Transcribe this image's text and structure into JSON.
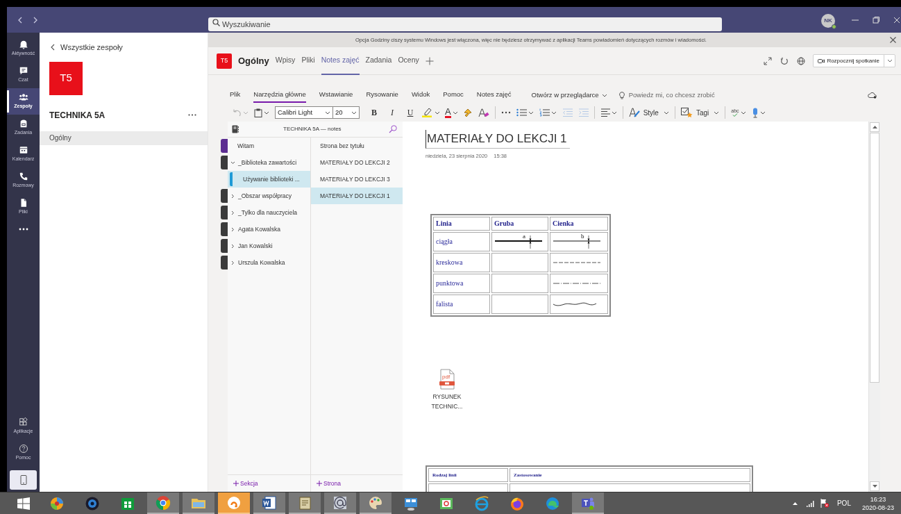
{
  "title_bar": {
    "search": {
      "placeholder": "Wyszukiwanie"
    },
    "avatar": "NK"
  },
  "rail": {
    "items": [
      {
        "kind": "bell",
        "label": "Aktywność",
        "selected": false
      },
      {
        "kind": "chat",
        "label": "Czat",
        "selected": false
      },
      {
        "kind": "people",
        "label": "Zespoły",
        "selected": true
      },
      {
        "kind": "bag",
        "label": "Zadania",
        "selected": false
      },
      {
        "kind": "calendar",
        "label": "Kalendarz",
        "selected": false
      },
      {
        "kind": "phone",
        "label": "Rozmowy",
        "selected": false
      },
      {
        "kind": "file",
        "label": "Pliki",
        "selected": false
      }
    ],
    "bottom_items": [
      {
        "kind": "apps",
        "label": "Aplikacje"
      },
      {
        "kind": "help",
        "label": "Pomoc"
      }
    ]
  },
  "team_panel": {
    "back": "Wszystkie zespoły",
    "tile": "T5",
    "name": "TECHNIKA 5A",
    "channels": [
      {
        "label": "Ogólny",
        "selected": true
      }
    ]
  },
  "banner": {
    "text": "Opcja Godziny ciszy systemu Windows jest włączona, więc nie będziesz otrzymywać z aplikacji Teams powiadomień dotyczących rozmów i wiadomości."
  },
  "header": {
    "tile": "T5",
    "channel": "Ogólny",
    "tabs": [
      {
        "label": "Wpisy",
        "selected": false
      },
      {
        "label": "Pliki",
        "selected": false
      },
      {
        "label": "Notes zajęć",
        "selected": true
      },
      {
        "label": "Zadania",
        "selected": false
      },
      {
        "label": "Oceny",
        "selected": false
      }
    ],
    "meeting_button": "Rozpocznij spotkanie"
  },
  "ribbon": {
    "tabs": [
      {
        "label": "Plik",
        "selected": false
      },
      {
        "label": "Narzędzia główne",
        "selected": true
      },
      {
        "label": "Wstawianie",
        "selected": false
      },
      {
        "label": "Rysowanie",
        "selected": false
      },
      {
        "label": "Widok",
        "selected": false
      },
      {
        "label": "Pomoc",
        "selected": false
      },
      {
        "label": "Notes zajęć",
        "selected": false
      }
    ],
    "open_in_browser": "Otwórz w przeglądarce",
    "tell_me": {
      "placeholder": "Powiedz mi, co chcesz zrobić"
    },
    "tools": [
      {
        "kind": "undo",
        "disabled": true
      },
      {
        "kind": "paste",
        "disabled": false
      },
      {
        "kind": "font",
        "label": "Calibri Light",
        "disabled": false
      },
      {
        "kind": "size",
        "label": "20",
        "disabled": false
      },
      {
        "kind": "bold",
        "label": "B",
        "disabled": false
      },
      {
        "kind": "italic",
        "label": "I",
        "disabled": false
      },
      {
        "kind": "underline",
        "label": "U",
        "disabled": false
      },
      {
        "kind": "highlight",
        "disabled": false
      },
      {
        "kind": "font_color",
        "label": "A",
        "disabled": false
      },
      {
        "kind": "painter",
        "disabled": false
      },
      {
        "kind": "clear",
        "disabled": false
      },
      {
        "kind": "more",
        "disabled": false
      },
      {
        "kind": "bullets",
        "disabled": false
      },
      {
        "kind": "numbering",
        "disabled": false
      },
      {
        "kind": "outdent",
        "disabled": true
      },
      {
        "kind": "indent",
        "disabled": true
      },
      {
        "kind": "align",
        "disabled": false
      },
      {
        "kind": "style",
        "label": "Style",
        "disabled": false
      },
      {
        "kind": "tags",
        "label": "Tagi",
        "disabled": false
      },
      {
        "kind": "spelling",
        "label": "abc",
        "disabled": false
      },
      {
        "kind": "dictate",
        "disabled": false
      }
    ]
  },
  "notebook": {
    "title": "TECHNIKA 5A — notes",
    "sections": [
      {
        "kind": "section",
        "label": "Witam",
        "color": "#5c2d91",
        "selected": false
      },
      {
        "kind": "group",
        "label": "_Biblioteka zawartości",
        "color": "#3b3b3b",
        "expanded": true,
        "selected": false,
        "children": [
          {
            "label": "Używanie biblioteki ...",
            "selected": true
          }
        ]
      },
      {
        "kind": "group",
        "label": "_Obszar współpracy",
        "color": "#3b3b3b",
        "expanded": false,
        "selected": false
      },
      {
        "kind": "group",
        "label": "_Tylko dla nauczyciela",
        "color": "#3b3b3b",
        "expanded": false,
        "selected": false
      },
      {
        "kind": "group",
        "label": "Agata Kowalska",
        "color": "#3b3b3b",
        "expanded": false,
        "selected": false
      },
      {
        "kind": "group",
        "label": "Jan Kowalski",
        "color": "#3b3b3b",
        "expanded": false,
        "selected": false
      },
      {
        "kind": "group",
        "label": "Urszula Kowalska",
        "color": "#3b3b3b",
        "expanded": false,
        "selected": false
      }
    ],
    "pages": [
      {
        "label": "Strona bez tytułu",
        "selected": false
      },
      {
        "label": "MATERIAŁY DO LEKCJI 2",
        "selected": false
      },
      {
        "label": "MATERIAŁY DO LEKCJI 3",
        "selected": false
      },
      {
        "label": "MATERIAŁY DO LEKCJI 1",
        "selected": true
      }
    ],
    "add_section": "Sekcja",
    "add_page": "Strona"
  },
  "page": {
    "title": "MATERIAŁY DO LEKCJI 1",
    "date": "niedziela, 23 sierpnia 2020",
    "time": "15:38",
    "table": {
      "columns": [
        "Linia",
        "Gruba",
        "Cienka"
      ],
      "rows": [
        {
          "label": "ciągła",
          "thick": {
            "kind": "solid",
            "mark": "a"
          },
          "thin": {
            "kind": "solid",
            "mark": "b"
          }
        },
        {
          "label": "kreskowa",
          "thin": {
            "kind": "dashed"
          }
        },
        {
          "label": "punktowa",
          "thin": {
            "kind": "dashdot"
          }
        },
        {
          "label": "falista",
          "thin": {
            "kind": "wavy"
          }
        }
      ]
    },
    "attachment_type": "pdf",
    "attachment": "RYSUNEK TECHNIC...",
    "table_2": {
      "columns": [
        "Rodzaj linii",
        "Zastosowanie"
      ]
    }
  },
  "taskbar": {
    "apps": [
      {
        "kind": "photos",
        "running": false,
        "flashing": false
      },
      {
        "kind": "camera",
        "running": false,
        "flashing": false
      },
      {
        "kind": "store",
        "running": false,
        "flashing": false
      },
      {
        "kind": "chrome",
        "running": true,
        "flashing": false
      },
      {
        "kind": "folder",
        "running": true,
        "flashing": false
      },
      {
        "kind": "avast",
        "running": true,
        "flashing": true
      },
      {
        "kind": "word",
        "running": true,
        "flashing": false
      },
      {
        "kind": "scroll",
        "running": true,
        "flashing": false
      },
      {
        "kind": "mail_at",
        "running": true,
        "flashing": false
      },
      {
        "kind": "paint",
        "running": true,
        "flashing": false
      },
      {
        "kind": "remote",
        "running": false,
        "flashing": false
      },
      {
        "kind": "mail_check",
        "running": false,
        "flashing": false
      },
      {
        "kind": "ie",
        "running": false,
        "flashing": false
      },
      {
        "kind": "firefox",
        "running": false,
        "flashing": false
      },
      {
        "kind": "edge",
        "running": false,
        "flashing": false
      },
      {
        "kind": "teams",
        "running": true,
        "flashing": false
      }
    ],
    "language": "POL",
    "time": "16:23",
    "date": "2020-08-23"
  }
}
